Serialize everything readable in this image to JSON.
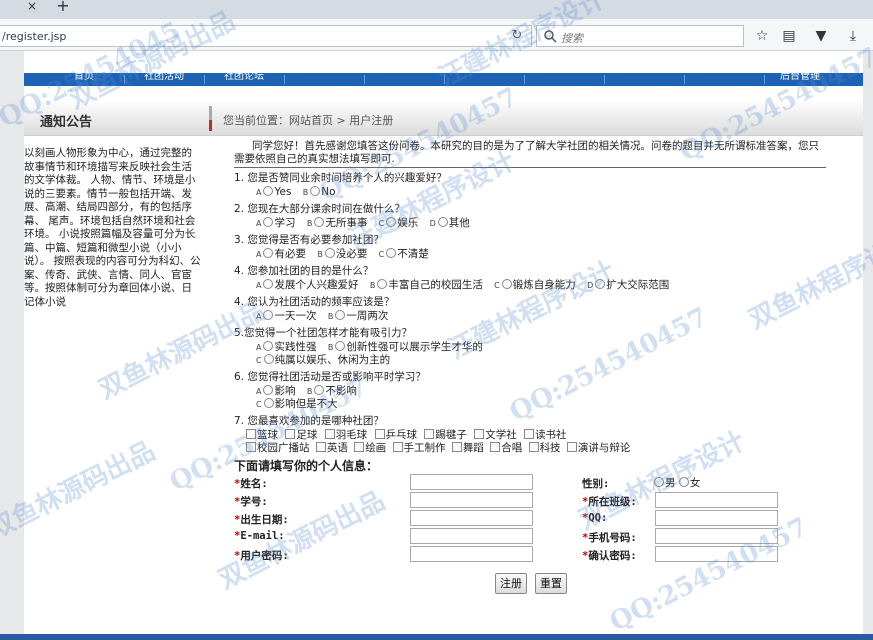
{
  "browser": {
    "url": "/register.jsp",
    "search_placeholder": "搜索",
    "tab_close": "×",
    "tab_new": "+"
  },
  "nav": {
    "items": [
      "首页",
      "社团活动",
      "社团论坛",
      "后台管理"
    ]
  },
  "header": {
    "notice_title": "通知公告",
    "breadcrumb": "您当前位置：网站首页 > 用户注册"
  },
  "sidebar": {
    "text": "以刻画人物形象为中心，通过完整的故事情节和环境描写来反映社会生活的文学体裁。 人物、情节、环境是小说的三要素。情节一般包括开端、发展、高潮、结局四部分，有的包括序幕、 尾声。环境包括自然环境和社会环境。 小说按照篇幅及容量可分为长篇、中篇、短篇和微型小说（小小说）。 按照表现的内容可分为科幻、公案、传奇、武侠、言情、同人、官宦等。按照体制可分为章回体小说、日记体小说"
  },
  "survey": {
    "intro": "同学您好！首先感谢您填答这份问卷。本研究的目的是为了了解大学社团的相关情况。问卷的题目并无所谓标准答案，您只需要依照自己的真实想法填写即可.",
    "questions": [
      {
        "q": "1.  您是否赞同业余时间培养个人的兴趣爱好？",
        "options": [
          [
            "A",
            "Yes"
          ],
          [
            "B",
            "No"
          ]
        ]
      },
      {
        "q": "2.  您现在大部分课余时间在做什么？",
        "options": [
          [
            "A",
            "学习"
          ],
          [
            "B",
            "无所事事"
          ],
          [
            "C",
            "娱乐"
          ],
          [
            "D",
            "其他"
          ]
        ]
      },
      {
        "q": "3.  您觉得是否有必要参加社团？",
        "options": [
          [
            "A",
            "有必要"
          ],
          [
            "B",
            "没必要"
          ],
          [
            "C",
            "不清楚"
          ]
        ]
      },
      {
        "q": "4.  您参加社团的目的是什么？",
        "options": [
          [
            "A",
            "发展个人兴趣爱好"
          ],
          [
            "B",
            "丰富自己的校园生活"
          ],
          [
            "C",
            "锻炼自身能力"
          ],
          [
            "D",
            "扩大交际范围"
          ]
        ]
      },
      {
        "q": "4.  您认为社团活动的频率应该是？",
        "options": [
          [
            "A",
            "一天一次"
          ],
          [
            "B",
            "一周两次"
          ]
        ]
      },
      {
        "q": "5.您觉得一个社团怎样才能有吸引力？",
        "options": [
          [
            "A",
            "实践性强"
          ],
          [
            "B",
            "创新性强可以展示学生才华的"
          ],
          [
            "C",
            "纯属以娱乐、休闲为主的"
          ]
        ]
      },
      {
        "q": "6.  您觉得社团活动是否或影响平时学习？",
        "options": [
          [
            "A",
            "影响"
          ],
          [
            "B",
            "不影响"
          ],
          [
            "C",
            "影响但是不大"
          ]
        ]
      },
      {
        "q": "7.  您最喜欢参加的是哪种社团？"
      }
    ],
    "clubs_row1": [
      "篮球",
      "足球",
      "羽毛球",
      "乒乓球",
      "踢毽子",
      "文学社",
      "读书社"
    ],
    "clubs_row2": [
      "校园广播站",
      "英语",
      "绘画",
      "手工制作",
      "舞蹈",
      "合唱",
      "科技",
      "演讲与辩论"
    ]
  },
  "form": {
    "title": "下面请填写你的个人信息：",
    "star": "*",
    "left_fields": [
      "姓名:",
      "学号:",
      "出生日期:",
      "E-mail:",
      "用户密码:"
    ],
    "right_fields": [
      "性别:",
      "所在班级:",
      "QQ:",
      "手机号码:",
      "确认密码:"
    ],
    "gender_male": "男",
    "gender_female": "女",
    "submit": "注册",
    "reset": "重置"
  },
  "watermarks": [
    "QQ:25454045",
    "双鱼林源码出品",
    "汪建林程序设计",
    "QQ:254540457",
    "双鱼林源码出品",
    "汪建林程序设计",
    "QQ:254540457",
    "双鱼林程序设计",
    "QQ:254540457",
    "双鱼林源码出品",
    "汪建林程序设计",
    "QQ:254540457",
    "双鱼林源码出品",
    "QQ:254540457",
    "双鱼林程序设计"
  ]
}
